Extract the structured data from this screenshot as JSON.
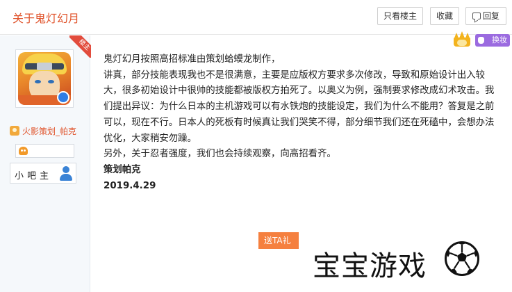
{
  "header": {
    "title": "关于鬼灯幻月",
    "buttons": {
      "only_op": "只看楼主",
      "favorite": "收藏",
      "reply": "回复"
    }
  },
  "sidebar": {
    "op_ribbon": "楼主",
    "username": "火影策划_帕克",
    "role": "小吧主"
  },
  "vip": {
    "swap_label": "换妆"
  },
  "post": {
    "paragraphs": [
      "鬼灯幻月按照高招标准由策划蛤蟆龙制作，",
      "讲真，部分技能表现我也不是很满意，主要是应版权方要求多次修改，导致和原始设计出入较大，很多初始设计中很帅的技能都被版权方拍死了。以奥义为例，强制要求修改成幻术攻击。我们提出异议：为什么日本的主机游戏可以有水铁炮的技能设定，我们为什么不能用？答复是之前可以，现在不行。日本人的死板有时候真让我们哭笑不得，部分细节我们还在死磕中，会想办法优化，大家稍安勿躁。",
      "另外，关于忍者强度，我们也会持续观察，向高招看齐。"
    ],
    "signature": "策划帕克",
    "date": "2019.4.29"
  },
  "gift_button": "送TA礼",
  "watermark": {
    "text": "宝宝游戏"
  },
  "colors": {
    "title": "#e0532b",
    "ribbon": "#e24c3d",
    "gift": "#f5803f",
    "vip": "#9b6be0"
  }
}
